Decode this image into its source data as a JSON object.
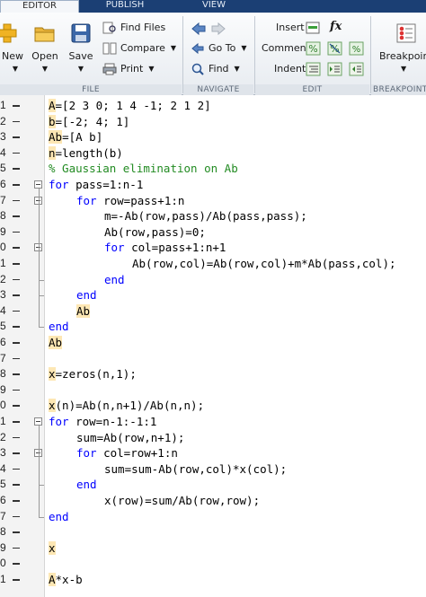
{
  "tabs": [
    {
      "label": "EDITOR",
      "active": true
    },
    {
      "label": "PUBLISH",
      "active": false
    },
    {
      "label": "VIEW",
      "active": false
    }
  ],
  "file_section": {
    "label": "FILE",
    "new_label": "New",
    "open_label": "Open",
    "save_label": "Save",
    "find_files_label": "Find Files",
    "compare_label": "Compare",
    "print_label": "Print"
  },
  "navigate_section": {
    "label": "NAVIGATE",
    "goto_label": "Go To",
    "find_label": "Find"
  },
  "edit_section": {
    "label": "EDIT",
    "insert_label": "Insert",
    "comment_label": "Comment",
    "indent_label": "Indent",
    "fx_label": "fx"
  },
  "breakpoints_section": {
    "label": "BREAKPOINTS",
    "button_label": "Breakpoints"
  },
  "dropdown_arrow": "▼",
  "code_lines": [
    {
      "num": "1",
      "text": "A=[2 3 0; 1 4 -1; 2 1 2]",
      "indent": 0
    },
    {
      "num": "2",
      "text": "b=[-2; 4; 1]",
      "indent": 0
    },
    {
      "num": "3",
      "text": "Ab=[A b]",
      "indent": 0
    },
    {
      "num": "4",
      "text": "n=length(b)",
      "indent": 0
    },
    {
      "num": "5",
      "text": "% Gaussian elimination on Ab",
      "indent": 0
    },
    {
      "num": "6",
      "text": "for pass=1:n-1",
      "indent": 0
    },
    {
      "num": "7",
      "text": "for row=pass+1:n",
      "indent": 1
    },
    {
      "num": "8",
      "text": "m=-Ab(row,pass)/Ab(pass,pass);",
      "indent": 2
    },
    {
      "num": "9",
      "text": "Ab(row,pass)=0;",
      "indent": 2
    },
    {
      "num": "0",
      "text": "for col=pass+1:n+1",
      "indent": 2
    },
    {
      "num": "1",
      "text": "Ab(row,col)=Ab(row,col)+m*Ab(pass,col);",
      "indent": 3
    },
    {
      "num": "2",
      "text": "end",
      "indent": 2
    },
    {
      "num": "3",
      "text": "end",
      "indent": 1
    },
    {
      "num": "4",
      "text": "Ab",
      "indent": 1
    },
    {
      "num": "5",
      "text": "end",
      "indent": 0
    },
    {
      "num": "6",
      "text": "Ab",
      "indent": 0
    },
    {
      "num": "7",
      "text": "",
      "indent": 0
    },
    {
      "num": "8",
      "text": "x=zeros(n,1);",
      "indent": 0
    },
    {
      "num": "9",
      "text": "",
      "indent": 0
    },
    {
      "num": "0",
      "text": "x(n)=Ab(n,n+1)/Ab(n,n);",
      "indent": 0
    },
    {
      "num": "1",
      "text": "for row=n-1:-1:1",
      "indent": 0
    },
    {
      "num": "2",
      "text": "sum=Ab(row,n+1);",
      "indent": 1
    },
    {
      "num": "3",
      "text": "for col=row+1:n",
      "indent": 1
    },
    {
      "num": "4",
      "text": "sum=sum-Ab(row,col)*x(col);",
      "indent": 2
    },
    {
      "num": "5",
      "text": "end",
      "indent": 1
    },
    {
      "num": "6",
      "text": "x(row)=sum/Ab(row,row);",
      "indent": 2
    },
    {
      "num": "7",
      "text": "end",
      "indent": 0
    },
    {
      "num": "8",
      "text": "",
      "indent": 0
    },
    {
      "num": "9",
      "text": "x",
      "indent": 0
    },
    {
      "num": "0",
      "text": "",
      "indent": 0
    },
    {
      "num": "1",
      "text": "A*x-b",
      "indent": 0
    }
  ],
  "colors": {
    "keyword": "#0000ff",
    "comment": "#228b22",
    "code": "#000000",
    "highlight": "#fde7b4",
    "tab_bar": "#1b3f74"
  }
}
